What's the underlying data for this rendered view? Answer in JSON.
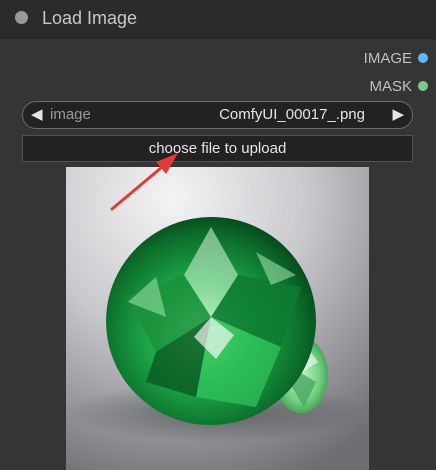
{
  "node": {
    "title": "Load Image",
    "outputs": [
      {
        "label": "IMAGE",
        "color": "#64b5f6"
      },
      {
        "label": "MASK",
        "color": "#81c784"
      }
    ],
    "image_widget": {
      "label": "image",
      "value": "ComfyUI_00017_.png",
      "prev_icon": "left-triangle-icon",
      "next_icon": "right-triangle-icon"
    },
    "upload_button": {
      "label": "choose file to upload"
    },
    "preview": {
      "subject": "green gemstone"
    }
  },
  "annotation": {
    "type": "arrow",
    "color": "#e53935"
  }
}
